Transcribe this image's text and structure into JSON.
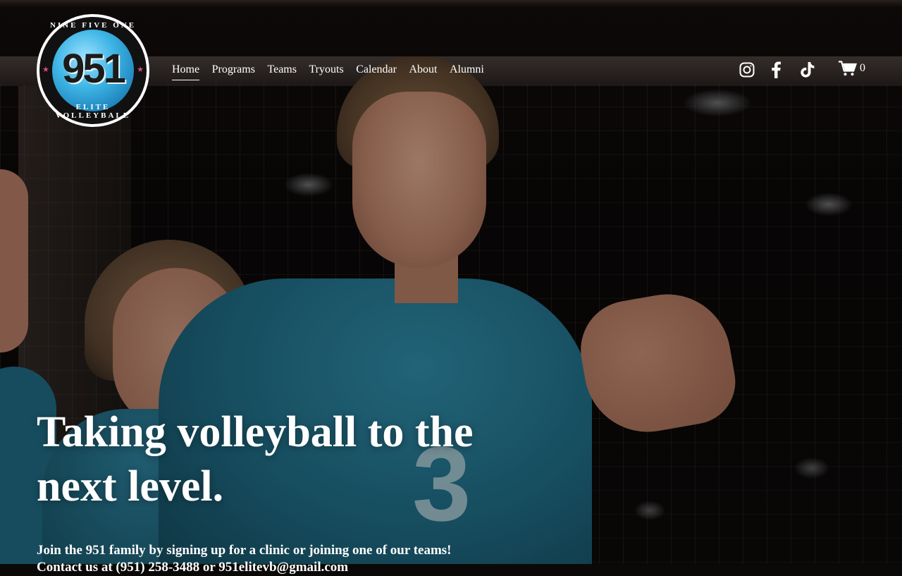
{
  "brand": {
    "logo_number": "951",
    "logo_top_text": "NINE FIVE ONE",
    "logo_bottom_text": "ELITE VOLLEYBALL",
    "accent_color": "#3fb6e6"
  },
  "nav": {
    "items": [
      {
        "label": "Home",
        "active": true
      },
      {
        "label": "Programs"
      },
      {
        "label": "Teams"
      },
      {
        "label": "Tryouts"
      },
      {
        "label": "Calendar"
      },
      {
        "label": "About"
      },
      {
        "label": "Alumni"
      }
    ]
  },
  "social": {
    "icons": [
      "instagram-icon",
      "facebook-icon",
      "tiktok-icon"
    ]
  },
  "cart": {
    "icon": "cart-icon",
    "count": "0"
  },
  "hero": {
    "headline_line1": "Taking volleyball to the",
    "headline_line2": "next level.",
    "subtext_line1": "Join the 951 family by signing up for a clinic or joining one of our teams!",
    "subtext_line2": "Contact us at (951) 258-3488 or 951elitevb@gmail.com",
    "photo_jersey_number": "3"
  }
}
